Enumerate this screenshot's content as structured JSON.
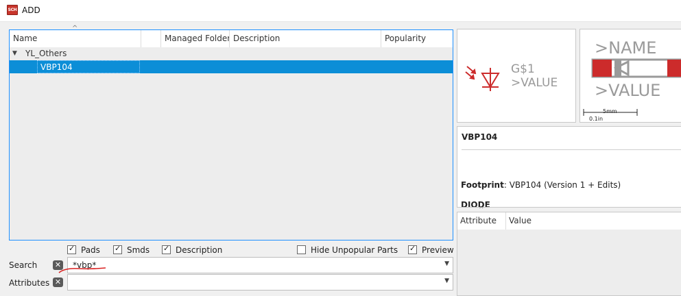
{
  "window": {
    "title": "ADD",
    "icon_text": "SCH"
  },
  "tree": {
    "columns": [
      "Name",
      "Managed Folder",
      "Description",
      "Popularity"
    ],
    "group": "YL_Others",
    "part": "VBP104"
  },
  "options": {
    "pads": "Pads",
    "smds": "Smds",
    "description": "Description",
    "hide_unpopular": "Hide Unpopular Parts",
    "preview": "Preview",
    "pads_checked": true,
    "smds_checked": true,
    "description_checked": true,
    "hide_unpopular_checked": false,
    "preview_checked": true
  },
  "search": {
    "label": "Search",
    "value": "*vbp*"
  },
  "attributes": {
    "label": "Attributes",
    "value": ""
  },
  "symbol_preview": {
    "name": "G$1",
    "value": ">VALUE"
  },
  "package_preview": {
    "name": ">NAME",
    "value": ">VALUE",
    "scale_mm": "5mm",
    "scale_in": "0.1in"
  },
  "info": {
    "title": "VBP104",
    "footprint_label": "Footprint",
    "footprint_value": ": VBP104 (Version 1 + Edits)",
    "type": "DIODE"
  },
  "attr_table": {
    "columns": [
      "Attribute",
      "Value"
    ]
  },
  "colors": {
    "selection": "#0c8ed7",
    "accent_border": "#1e90ff",
    "symbol_red": "#cc2b2b",
    "symbol_gray": "#9a9a9a"
  }
}
